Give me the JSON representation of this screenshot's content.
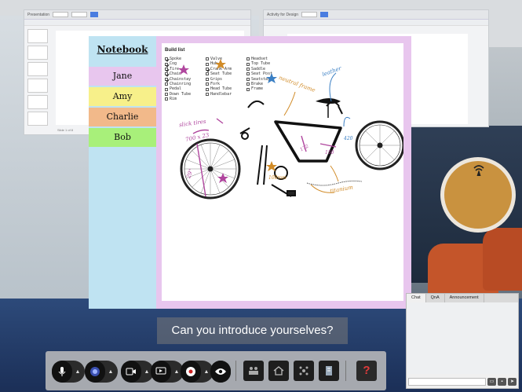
{
  "background": {
    "left_doc_title": "Presentation",
    "right_doc_title": "Activity for Design",
    "left_doc_slide_label": "Slide 1 of 8"
  },
  "whiteboard": {
    "title": "Notebook",
    "names": [
      {
        "label": "Jane",
        "color": "#e8c6ee"
      },
      {
        "label": "Amy",
        "color": "#f7f08a"
      },
      {
        "label": "Charlie",
        "color": "#f2b98a"
      },
      {
        "label": "Bob",
        "color": "#a8f07a"
      }
    ],
    "build_list_title": "Build list",
    "build_list": [
      [
        {
          "label": "Spoke",
          "checked": true
        },
        {
          "label": "Cog",
          "checked": true
        },
        {
          "label": "Tire",
          "checked": true
        },
        {
          "label": "Chain",
          "checked": true
        },
        {
          "label": "Chainstay",
          "checked": true
        },
        {
          "label": "Chainring",
          "checked": false
        },
        {
          "label": "Pedal",
          "checked": false
        },
        {
          "label": "Down Tube",
          "checked": false
        },
        {
          "label": "Rim",
          "checked": false
        }
      ],
      [
        {
          "label": "Valve",
          "checked": false
        },
        {
          "label": "Hub",
          "checked": false
        },
        {
          "label": "Crank Arm",
          "checked": true
        },
        {
          "label": "Seat Tube",
          "checked": false
        },
        {
          "label": "Grips",
          "checked": false
        },
        {
          "label": "Fork",
          "checked": false
        },
        {
          "label": "Head Tube",
          "checked": false
        },
        {
          "label": "Handlebar",
          "checked": false
        }
      ],
      [
        {
          "label": "Headset",
          "checked": false
        },
        {
          "label": "Top Tube",
          "checked": false
        },
        {
          "label": "Saddle",
          "checked": false
        },
        {
          "label": "Seat Post",
          "checked": false
        },
        {
          "label": "Seatstay",
          "checked": false
        },
        {
          "label": "Brake",
          "checked": false
        },
        {
          "label": "Frame",
          "checked": false
        }
      ]
    ],
    "annotations": {
      "slick_tires": "slick tires",
      "tire_size": "700 x 23",
      "wheel_size": "29\"",
      "neutral_frame": "neutral frame",
      "leather": "leather",
      "titanium": "titanium",
      "num_100": "100mm",
      "num_172": "172",
      "num_150": "150",
      "num_420": "420"
    }
  },
  "chat_panel": {
    "tabs": [
      "Chat",
      "QnA",
      "Announcement"
    ],
    "active_tab": "Chat"
  },
  "caption": "Can you introduce yourselves?",
  "dock": {
    "help_label": "?"
  }
}
